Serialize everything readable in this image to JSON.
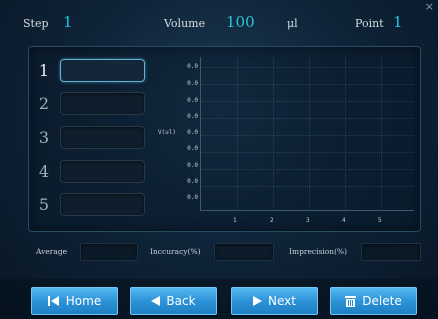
{
  "header": {
    "step_label": "Step",
    "step_value": "1",
    "volume_label": "Volume",
    "volume_value": "100",
    "volume_unit": "μl",
    "point_label": "Point",
    "point_value": "1",
    "close_symbol": "×"
  },
  "rows": [
    {
      "label": "1",
      "value": ""
    },
    {
      "label": "2",
      "value": ""
    },
    {
      "label": "3",
      "value": ""
    },
    {
      "label": "4",
      "value": ""
    },
    {
      "label": "5",
      "value": ""
    }
  ],
  "active_row": 1,
  "chart_data": {
    "type": "line",
    "ylabel": "V(ul)",
    "y_ticks": [
      "0.0",
      "0.0",
      "0.0",
      "0.0",
      "0.0",
      "0.0",
      "0.0",
      "0.0",
      "0.0"
    ],
    "x_ticks": [
      "1",
      "2",
      "3",
      "4",
      "5"
    ],
    "series": [],
    "grid": true
  },
  "stats": {
    "average_label": "Average",
    "average_value": "",
    "inaccuracy_label": "Inccuracy(%)",
    "inaccuracy_value": "",
    "imprecision_label": "Imprecision(%)",
    "imprecision_value": ""
  },
  "buttons": {
    "home": "Home",
    "back": "Back",
    "next": "Next",
    "delete": "Delete"
  },
  "colors": {
    "accent": "#29c4e0",
    "button": "#2d93d8"
  },
  "icons": {
    "home": "skip-back-icon",
    "back": "triangle-left-icon",
    "next": "triangle-right-icon",
    "delete": "trash-icon"
  }
}
